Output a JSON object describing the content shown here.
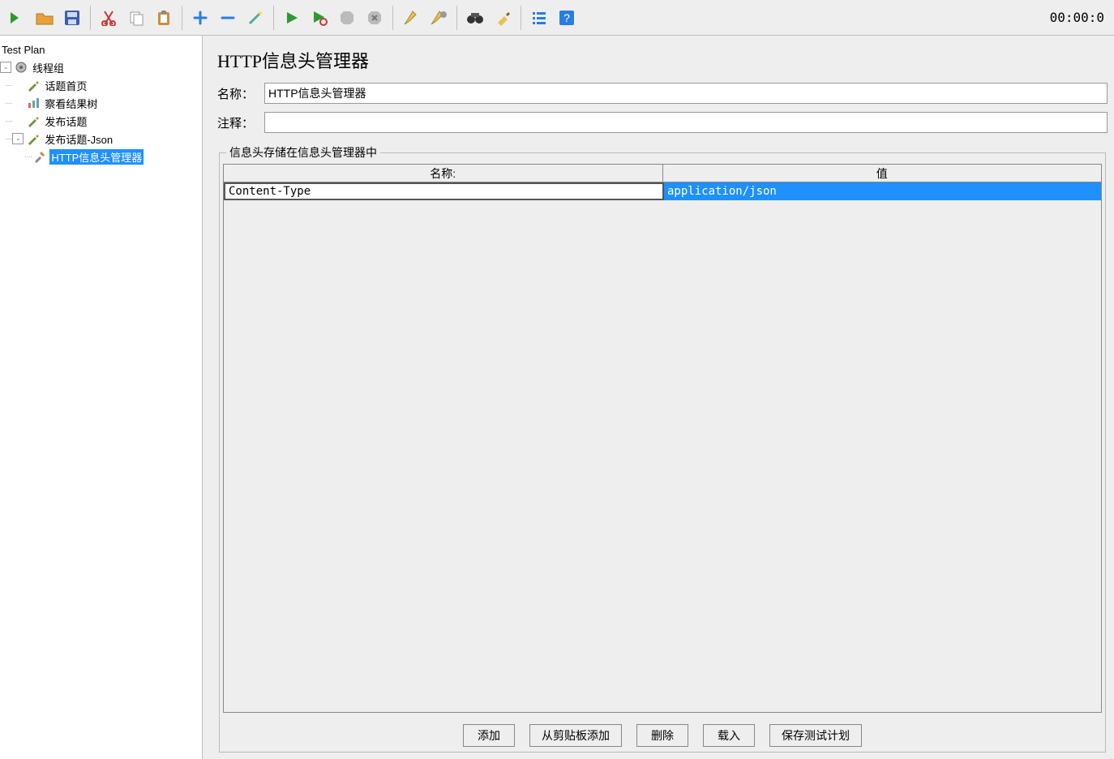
{
  "timer": "00:00:0",
  "toolbar_icons": [
    "open-arrow",
    "open-folder",
    "save",
    "",
    "cut",
    "copy",
    "paste",
    "",
    "plus",
    "minus",
    "wand",
    "",
    "run",
    "run-loop",
    "stop",
    "stop-x",
    "",
    "broom",
    "broom-gear",
    "",
    "binoculars",
    "brush",
    "",
    "list",
    "help"
  ],
  "tree": {
    "root": "Test Plan",
    "thread_group": "线程组",
    "items": [
      {
        "label": "话题首页",
        "icon": "pen"
      },
      {
        "label": "察看结果树",
        "icon": "chart"
      },
      {
        "label": "发布话题",
        "icon": "pen"
      },
      {
        "label": "发布话题-Json",
        "icon": "pen",
        "expanded": true,
        "children": [
          {
            "label": "HTTP信息头管理器",
            "icon": "tools",
            "selected": true
          }
        ]
      }
    ]
  },
  "panel": {
    "title": "HTTP信息头管理器",
    "name_label": "名称：",
    "name_value": "HTTP信息头管理器",
    "comment_label": "注释：",
    "comment_value": "",
    "fieldset_title": "信息头存储在信息头管理器中",
    "columns": [
      "名称:",
      "值"
    ],
    "rows": [
      {
        "name": "Content-Type",
        "value": "application/json"
      }
    ],
    "buttons": [
      "添加",
      "从剪贴板添加",
      "删除",
      "载入",
      "保存测试计划"
    ]
  }
}
